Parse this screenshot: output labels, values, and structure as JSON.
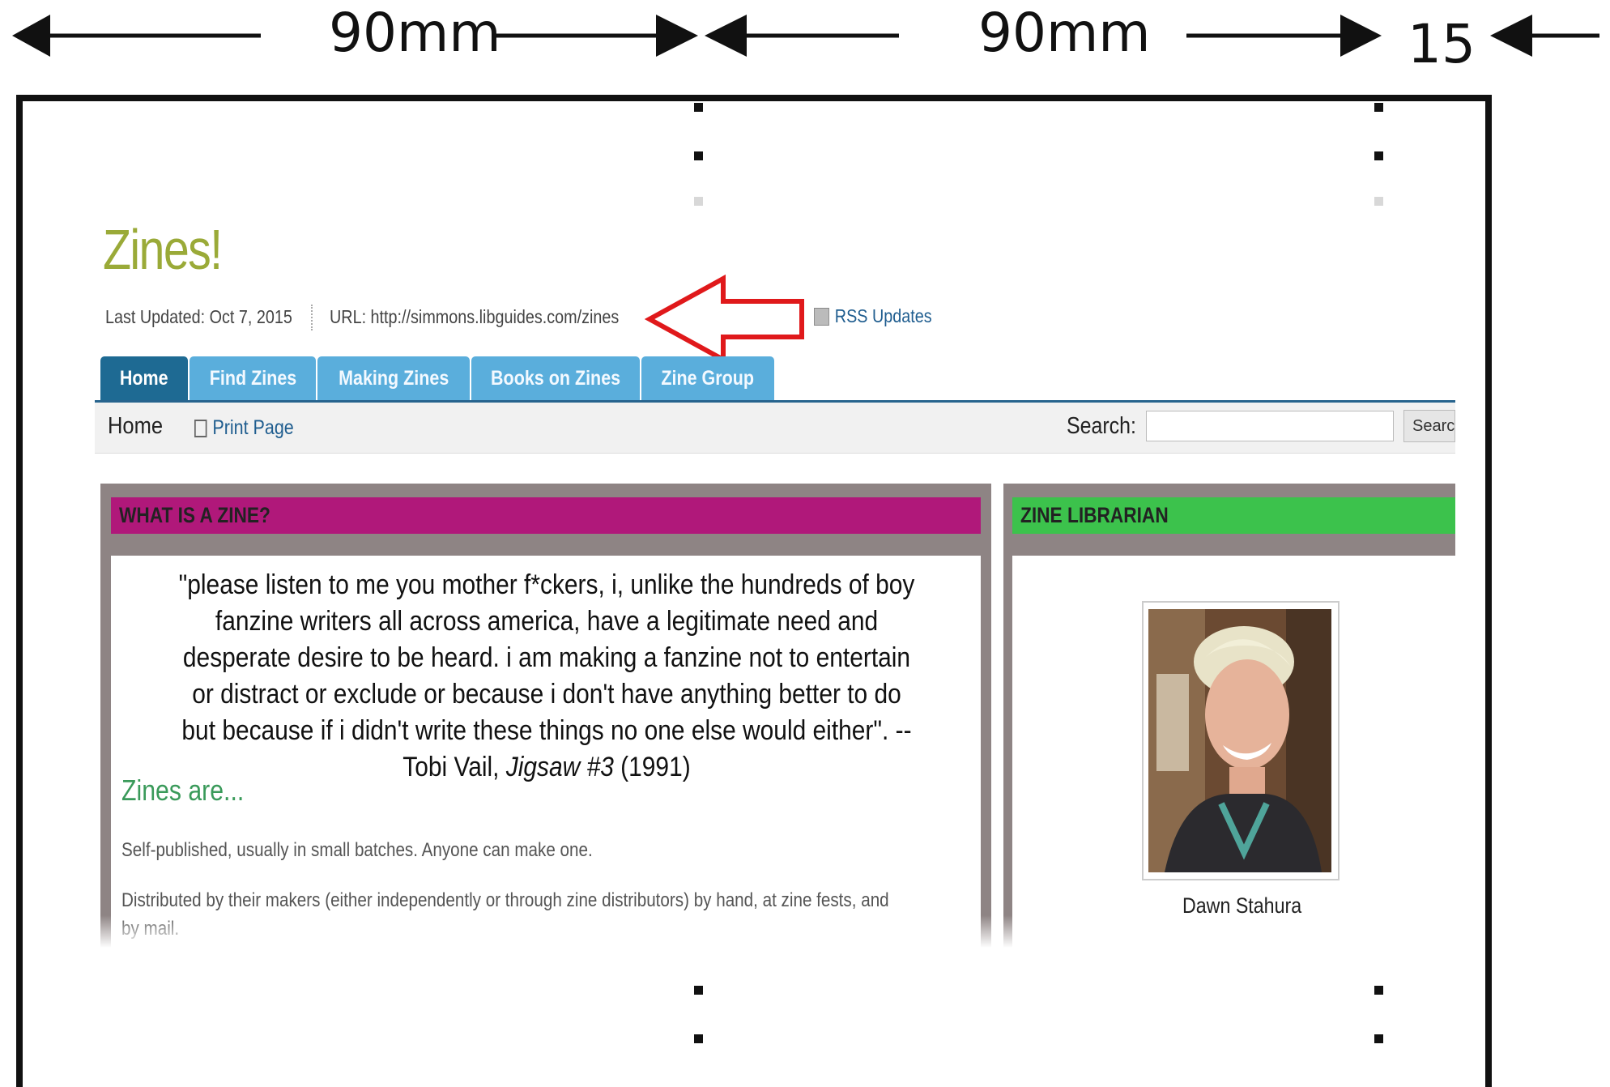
{
  "dimensions": {
    "left_width": "90mm",
    "right_width": "90mm",
    "margin": "15"
  },
  "guide": {
    "title": "Zines!",
    "last_updated": "Last Updated: Oct 7, 2015",
    "url": "URL: http://simmons.libguides.com/zines",
    "rss": "RSS Updates"
  },
  "tabs": [
    {
      "label": "Home",
      "active": true
    },
    {
      "label": "Find Zines",
      "active": false
    },
    {
      "label": "Making Zines",
      "active": false
    },
    {
      "label": "Books on Zines",
      "active": false
    },
    {
      "label": "Zine Group",
      "active": false
    }
  ],
  "subnav": {
    "breadcrumb": "Home",
    "print": "Print Page",
    "search_label": "Search:",
    "search_value": "",
    "search_button": "Search"
  },
  "zine_box": {
    "header": "WHAT IS A ZINE?",
    "header_color": "#b0187a",
    "quote_text": "\"please listen to me you mother f*ckers, i, unlike the hundreds of boy fanzine writers all across america, have a legitimate need and desperate desire to be heard. i am making a fanzine not to entertain or distract or exclude or because i don't have anything better to do but because if i didn't write these things no one else would either\". --Tobi Vail, ",
    "quote_title": "Jigsaw #3",
    "quote_year": " (1991)",
    "subheading": "Zines are...",
    "items": [
      "Self-published, usually in small batches. Anyone can make one.",
      "Distributed by their makers (either independently or through zine distributors) by hand, at zine fests, and by mail."
    ]
  },
  "librarian_box": {
    "header": "ZINE LIBRARIAN",
    "header_color": "#3cc24c",
    "name": "Dawn Stahura"
  },
  "colors": {
    "title_green": "#9aaa38",
    "tab_active": "#1e6a93",
    "tab_inactive": "#5aaedc",
    "callout_arrow": "#e0191b",
    "box_border": "#8e8484",
    "subheading_green": "#3a9a5a"
  },
  "icons": [
    "left-arrow-icon",
    "right-arrow-icon",
    "callout-arrow-icon",
    "rss-icon",
    "printer-icon"
  ]
}
